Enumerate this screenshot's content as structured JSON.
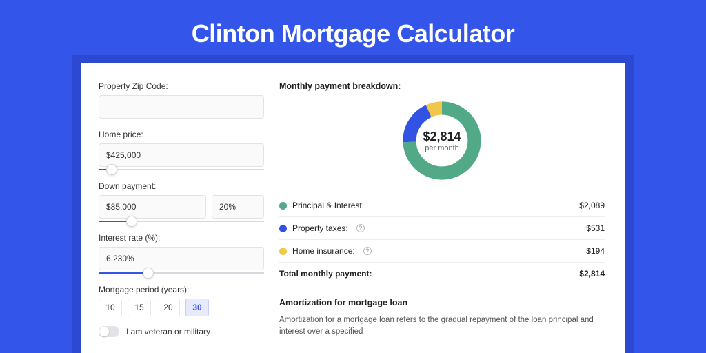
{
  "title": "Clinton Mortgage Calculator",
  "colors": {
    "accent": "#3355e9",
    "pi": "#52a988",
    "taxes": "#3252e3",
    "insurance": "#f1c649"
  },
  "form": {
    "zip": {
      "label": "Property Zip Code:",
      "value": ""
    },
    "price": {
      "label": "Home price:",
      "value": "$425,000",
      "slider_pct": 8
    },
    "down": {
      "label": "Down payment:",
      "value": "$85,000",
      "pct_value": "20%",
      "slider_pct": 20
    },
    "rate": {
      "label": "Interest rate (%):",
      "value": "6.230%",
      "slider_pct": 30
    },
    "period": {
      "label": "Mortgage period (years):",
      "options": [
        "10",
        "15",
        "20",
        "30"
      ],
      "selected": "30"
    },
    "veteran": {
      "label": "I am veteran or military",
      "on": false
    }
  },
  "breakdown": {
    "heading": "Monthly payment breakdown:",
    "total_display": "$2,814",
    "per_month": "per month",
    "items": [
      {
        "key": "pi",
        "label": "Principal & Interest:",
        "value": "$2,089",
        "help": false
      },
      {
        "key": "taxes",
        "label": "Property taxes:",
        "value": "$531",
        "help": true
      },
      {
        "key": "insurance",
        "label": "Home insurance:",
        "value": "$194",
        "help": true
      }
    ],
    "total_label": "Total monthly payment:",
    "total_value": "$2,814"
  },
  "amortization": {
    "heading": "Amortization for mortgage loan",
    "text": "Amortization for a mortgage loan refers to the gradual repayment of the loan principal and interest over a specified"
  },
  "chart_data": {
    "type": "pie",
    "title": "Monthly payment breakdown",
    "total": 2814,
    "series": [
      {
        "name": "Principal & Interest",
        "value": 2089,
        "color": "#52a988"
      },
      {
        "name": "Property taxes",
        "value": 531,
        "color": "#3252e3"
      },
      {
        "name": "Home insurance",
        "value": 194,
        "color": "#f1c649"
      }
    ]
  }
}
